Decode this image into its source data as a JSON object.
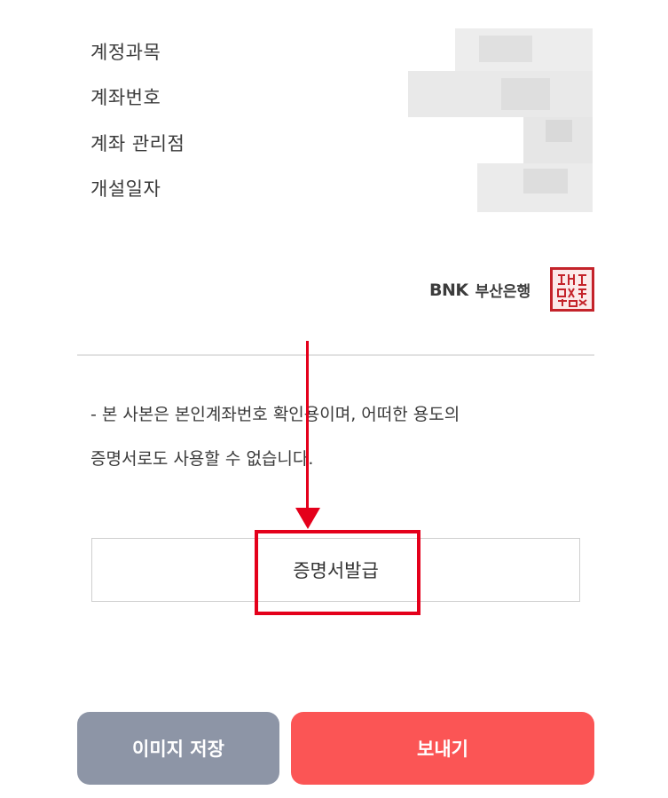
{
  "account_info": {
    "labels": [
      "계정과목",
      "계좌번호",
      "계좌 관리점",
      "개설일자"
    ]
  },
  "bank": {
    "logo_text": "BNK",
    "name": "부산은행",
    "seal_icon": "bank-seal-stamp"
  },
  "notice": {
    "line1": "- 본 사본은 본인계좌번호 확인용이며, 어떠한 용도의",
    "line2": "증명서로도 사용할 수 없습니다."
  },
  "issue_button": {
    "label": "증명서발급"
  },
  "annotation": {
    "color": "#e4001b"
  },
  "footer": {
    "save_label": "이미지 저장",
    "send_label": "보내기",
    "save_color": "#8d95a6",
    "send_color": "#fb5555"
  }
}
